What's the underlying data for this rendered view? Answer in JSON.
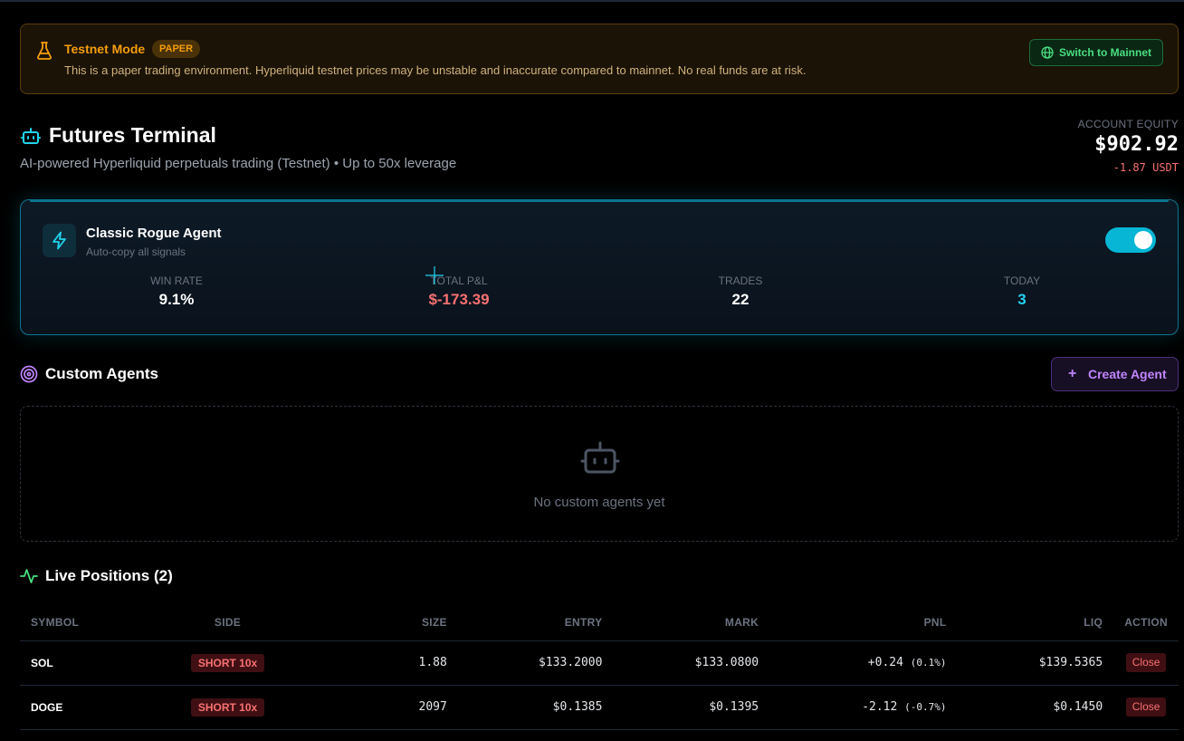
{
  "banner": {
    "title": "Testnet Mode",
    "badge": "PAPER",
    "message": "This is a paper trading environment. Hyperliquid testnet prices may be unstable and inaccurate compared to mainnet. No real funds are at risk.",
    "button_label": "Switch to Mainnet",
    "icon": "flask-icon",
    "button_icon": "globe-icon"
  },
  "header": {
    "title": "Futures Terminal",
    "subtitle": "AI-powered Hyperliquid perpetuals trading (Testnet) • Up to 50x leverage",
    "icon": "bot-icon",
    "equity_label": "ACCOUNT EQUITY",
    "equity_value": "$902.92",
    "equity_change": "-1.87 USDT"
  },
  "agent": {
    "name": "Classic Rogue Agent",
    "subtitle": "Auto-copy all signals",
    "icon": "lightning-icon",
    "enabled": true,
    "stats": {
      "win_rate_label": "WIN RATE",
      "win_rate": "9.1%",
      "total_pnl_label": "TOTAL P&L",
      "total_pnl": "$-173.39",
      "trades_label": "TRADES",
      "trades": "22",
      "today_label": "TODAY",
      "today": "3"
    }
  },
  "custom_agents": {
    "title": "Custom Agents",
    "icon": "target-icon",
    "create_label": "Create Agent",
    "empty_text": "No custom agents yet"
  },
  "positions": {
    "title": "Live Positions (2)",
    "icon": "activity-icon",
    "columns": [
      "SYMBOL",
      "SIDE",
      "SIZE",
      "ENTRY",
      "MARK",
      "PNL",
      "LIQ",
      "ACTION"
    ],
    "rows": [
      {
        "symbol": "SOL",
        "side": "SHORT 10x",
        "size": "1.88",
        "entry": "$133.2000",
        "mark": "$133.0800",
        "pnl": "+0.24",
        "pnl_pct": "(0.1%)",
        "liq": "$139.5365",
        "action": "Close"
      },
      {
        "symbol": "DOGE",
        "side": "SHORT 10x",
        "size": "2097",
        "entry": "$0.1385",
        "mark": "$0.1395",
        "pnl": "-2.12",
        "pnl_pct": "(-0.7%)",
        "liq": "$0.1450",
        "action": "Close"
      }
    ]
  },
  "colors": {
    "warning": "#f59e0b",
    "success": "#4ade80",
    "danger": "#f87171",
    "accent": "#06b6d4",
    "purple": "#c084fc",
    "liq": "#fb923c"
  }
}
